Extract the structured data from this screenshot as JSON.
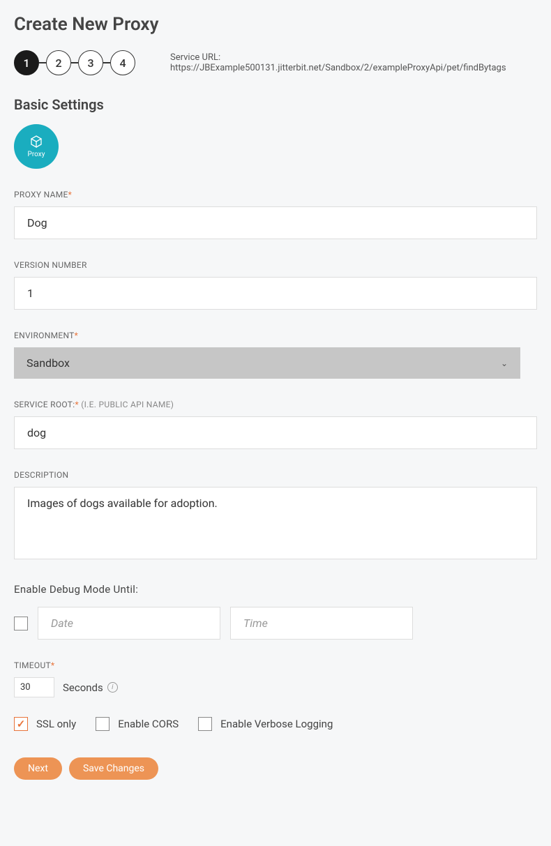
{
  "page_title": "Create New Proxy",
  "stepper": {
    "steps": [
      "1",
      "2",
      "3",
      "4"
    ],
    "active_index": 0
  },
  "service_url_label": "Service URL: ",
  "service_url_value": "https://JBExample500131.jitterbit.net/Sandbox/2/exampleProxyApi/pet/findBytags",
  "section_title": "Basic Settings",
  "proxy_icon_label": "Proxy",
  "fields": {
    "proxy_name": {
      "label": "PROXY NAME",
      "value": "Dog"
    },
    "version": {
      "label": "VERSION NUMBER",
      "value": "1"
    },
    "environment": {
      "label": "ENVIRONMENT",
      "value": "Sandbox"
    },
    "service_root": {
      "label": "SERVICE ROOT:",
      "hint": " (I.E. PUBLIC API NAME)",
      "value": "dog"
    },
    "description": {
      "label": "DESCRIPTION",
      "value": "Images of dogs available for adoption."
    }
  },
  "debug": {
    "label": "Enable Debug Mode Until:",
    "date_placeholder": "Date",
    "time_placeholder": "Time",
    "checked": false
  },
  "timeout": {
    "label": "TIMEOUT",
    "value": "30",
    "unit": "Seconds"
  },
  "options": {
    "ssl": {
      "label": "SSL only",
      "checked": true
    },
    "cors": {
      "label": "Enable CORS",
      "checked": false
    },
    "verbose": {
      "label": "Enable Verbose Logging",
      "checked": false
    }
  },
  "buttons": {
    "next": "Next",
    "save": "Save Changes"
  }
}
